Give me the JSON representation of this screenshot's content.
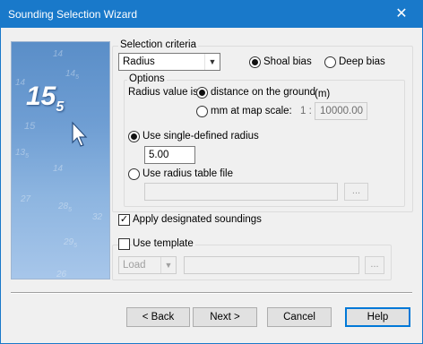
{
  "window": {
    "title": "Sounding Selection Wizard",
    "close_glyph": "✕"
  },
  "banner": {
    "big_depth": "15",
    "big_depth_sub": "5",
    "soundings": [
      {
        "main": "14",
        "sub": ""
      },
      {
        "main": "14",
        "sub": "5"
      },
      {
        "main": "14",
        "sub": ""
      },
      {
        "main": "15",
        "sub": ""
      },
      {
        "main": "13",
        "sub": "5"
      },
      {
        "main": "14",
        "sub": ""
      },
      {
        "main": "27",
        "sub": ""
      },
      {
        "main": "28",
        "sub": "5"
      },
      {
        "main": "32",
        "sub": ""
      },
      {
        "main": "29",
        "sub": "5"
      },
      {
        "main": "26",
        "sub": ""
      }
    ],
    "cursor_icon": "arrow-cursor-icon"
  },
  "selection_criteria": {
    "legend": "Selection criteria",
    "criteria_value": "Radius",
    "shoal_bias_label": "Shoal bias",
    "deep_bias_label": "Deep bias",
    "shoal_bias_selected": true
  },
  "options": {
    "legend": "Options",
    "radius_value_label": "Radius value is",
    "distance_label": "distance on the ground",
    "distance_unit": "(m)",
    "mm_label": "mm at map scale:",
    "scale_prefix": "1 :",
    "scale_value": "10000.00",
    "distance_selected": true,
    "single_radius_label": "Use single-defined radius",
    "single_radius_selected": true,
    "radius_value": "5.00",
    "radius_table_label": "Use radius table file",
    "radius_table_path": "",
    "browse_label": "..."
  },
  "apply_designated": {
    "label": "Apply designated soundings",
    "checked": true
  },
  "template": {
    "label": "Use template",
    "checked": false,
    "load_value": "Load",
    "template_name": "",
    "browse_label": "..."
  },
  "buttons": {
    "back": "< Back",
    "next": "Next >",
    "cancel": "Cancel",
    "help": "Help"
  },
  "colors": {
    "titlebar": "#1979ca",
    "dialog_bg": "#f0f0f0",
    "default_button_border": "#0078d7"
  }
}
